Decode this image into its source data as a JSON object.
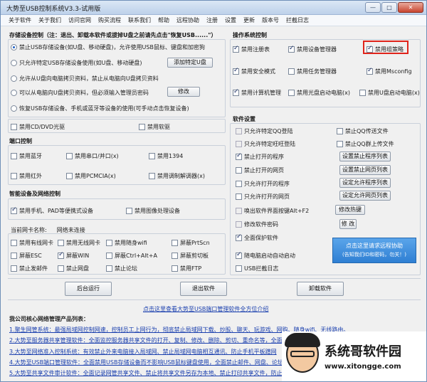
{
  "window": {
    "title": "大势至USB控制系统V3.3-试用版",
    "min": "—",
    "max": "□",
    "close": "✕"
  },
  "menu": [
    "关于软件",
    "关于我们",
    "访问官网",
    "购买流程",
    "联系我们",
    "帮助",
    "远程协助",
    "注册",
    "设置",
    "更新",
    "版本号",
    "拦截日志"
  ],
  "storage": {
    "title": "存储设备控制（注：退出、卸载本软件或拔掉U盘之前请先点击\"恢复USB......\"）",
    "options": [
      "禁止USB存储设备(如U盘、移动硬盘)，允许使用USB鼠标、键盘和加密狗",
      "只允许特定USB存储设备使用(如U盘、移动硬盘)",
      "允许从U盘向电脑拷贝资料，禁止从电脑向U盘拷贝资料",
      "可以从电脑向U盘拷贝资料，但必须输入管理员密码",
      "恢复USB存储设备、手机或蓝牙等设备的使用(可手动点击恢复设备)"
    ],
    "add_button": "添加特定U盘",
    "modify_button": "修改",
    "cd": "禁用CD/DVD光驱",
    "floppy": "禁用软驱"
  },
  "ports": {
    "title": "端口控制",
    "items": [
      "禁用蓝牙",
      "禁用串口/并口(x)",
      "禁用1394",
      "禁用红外",
      "禁用PCMCIA(x)",
      "禁用调制解调器(x)"
    ]
  },
  "smart": {
    "title": "智能设备及网络控制",
    "items": [
      "禁用手机、PAD等便携式设备",
      "禁用图像处理设备"
    ]
  },
  "netcard": {
    "label": "当前网卡名称:",
    "value": "网络未连接",
    "items": [
      "禁用有线网卡",
      "禁用无线网卡",
      "禁用随身wifi",
      "屏蔽PrtScn",
      "屏蔽ESC",
      "屏蔽WIN",
      "屏蔽Ctrl+Alt+A",
      "屏蔽剪切板",
      "禁止发邮件",
      "禁止网盘",
      "禁止论坛",
      "禁用FTP"
    ]
  },
  "os": {
    "title": "操作系统控制",
    "items": [
      "禁用注册表",
      "禁用设备管理器",
      "禁用组策略",
      "禁用安全模式",
      "禁用任务管理器",
      "禁用Msconfig",
      "禁用计算机管理",
      "禁用光盘启动电脑(x)",
      "禁用U盘启动电脑(x)"
    ]
  },
  "software": {
    "title": "软件设置",
    "left": [
      "只允许特定QQ登陆",
      "只允许特定旺旺登陆",
      "禁止打开的程序",
      "禁止打开的网页",
      "只允许打开的程序",
      "只允许打开的网页",
      "唤出软件界面按键Alt+F2",
      "修改软件密码",
      "全面保护软件",
      "随电脑启动自动启动",
      "USB拦截日志"
    ],
    "right_checks": [
      "禁止QQ传送文件",
      "禁止QQ群上传文件"
    ],
    "buttons": [
      "设置禁止程序列表",
      "设置禁止网页列表",
      "设定允许程序列表",
      "设定允许网页列表",
      "修改热键",
      "修 改"
    ],
    "remote_main": "点击这里请求远程协助",
    "remote_sub": "(告知我们ID和密码，勿关！)"
  },
  "actions": {
    "background": "后台运行",
    "exit": "退出软件",
    "uninstall": "卸载软件"
  },
  "center_link": "点击这里查看大势至USB端口管理软件全方位介绍",
  "products_title": "我公司核心网络管理产品列表：",
  "products": [
    "1.聚生网管系统：最强局域网控制网速，控制员工上网行为，彻底禁止局域网下载、炒股、聊天、玩游戏、网购、随身wifi、无线路由。",
    "2.大势至服务器共享管理软件：全面监控服务器共享文件的打开、复制、修改、删除、剪切、重命名等，全面防止服务器共享文件泄密",
    "3.大势至网络准入控制系统：有效禁止外来电脑接入局域网、禁止局域网电脑相互通讯、防止手机平板蹭网",
    "4.大势至USB端口管理软件：全面禁用USB存储设备而不影响USB鼠标键盘使用，全面禁止邮件、网盘、论坛发帖",
    "5.大势至共享文件审计软件：全面记录网管共享文件、禁止将共享文件另存为本地、禁止打印共享文件，防止泄密"
  ],
  "watermark": {
    "title": "系统哥软件园",
    "url": "www.xitongge.com"
  }
}
